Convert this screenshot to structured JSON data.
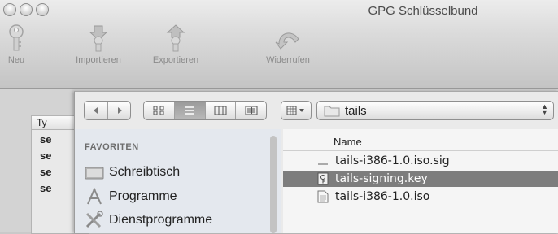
{
  "window": {
    "title": "GPG Schlüsselbund"
  },
  "toolbar": {
    "new_label": "Neu",
    "import_label": "Importieren",
    "export_label": "Exportieren",
    "undo_label": "Widerrufen"
  },
  "key_table": {
    "header": "Ty",
    "rows": [
      "se",
      "se",
      "se",
      "se"
    ]
  },
  "dialog": {
    "path_popup": "tails",
    "sidebar": {
      "section": "FAVORITEN",
      "items": [
        {
          "label": "Schreibtisch",
          "icon": "desktop-icon"
        },
        {
          "label": "Programme",
          "icon": "applications-icon"
        },
        {
          "label": "Dienstprogramme",
          "icon": "utilities-icon"
        }
      ]
    },
    "file_list": {
      "column_header": "Name",
      "files": [
        {
          "name": "tails-i386-1.0.iso.sig",
          "icon": "signature-file-icon",
          "selected": false
        },
        {
          "name": "tails-signing.key",
          "icon": "key-file-icon",
          "selected": true
        },
        {
          "name": "tails-i386-1.0.iso",
          "icon": "disk-image-icon",
          "selected": false
        }
      ]
    }
  }
}
